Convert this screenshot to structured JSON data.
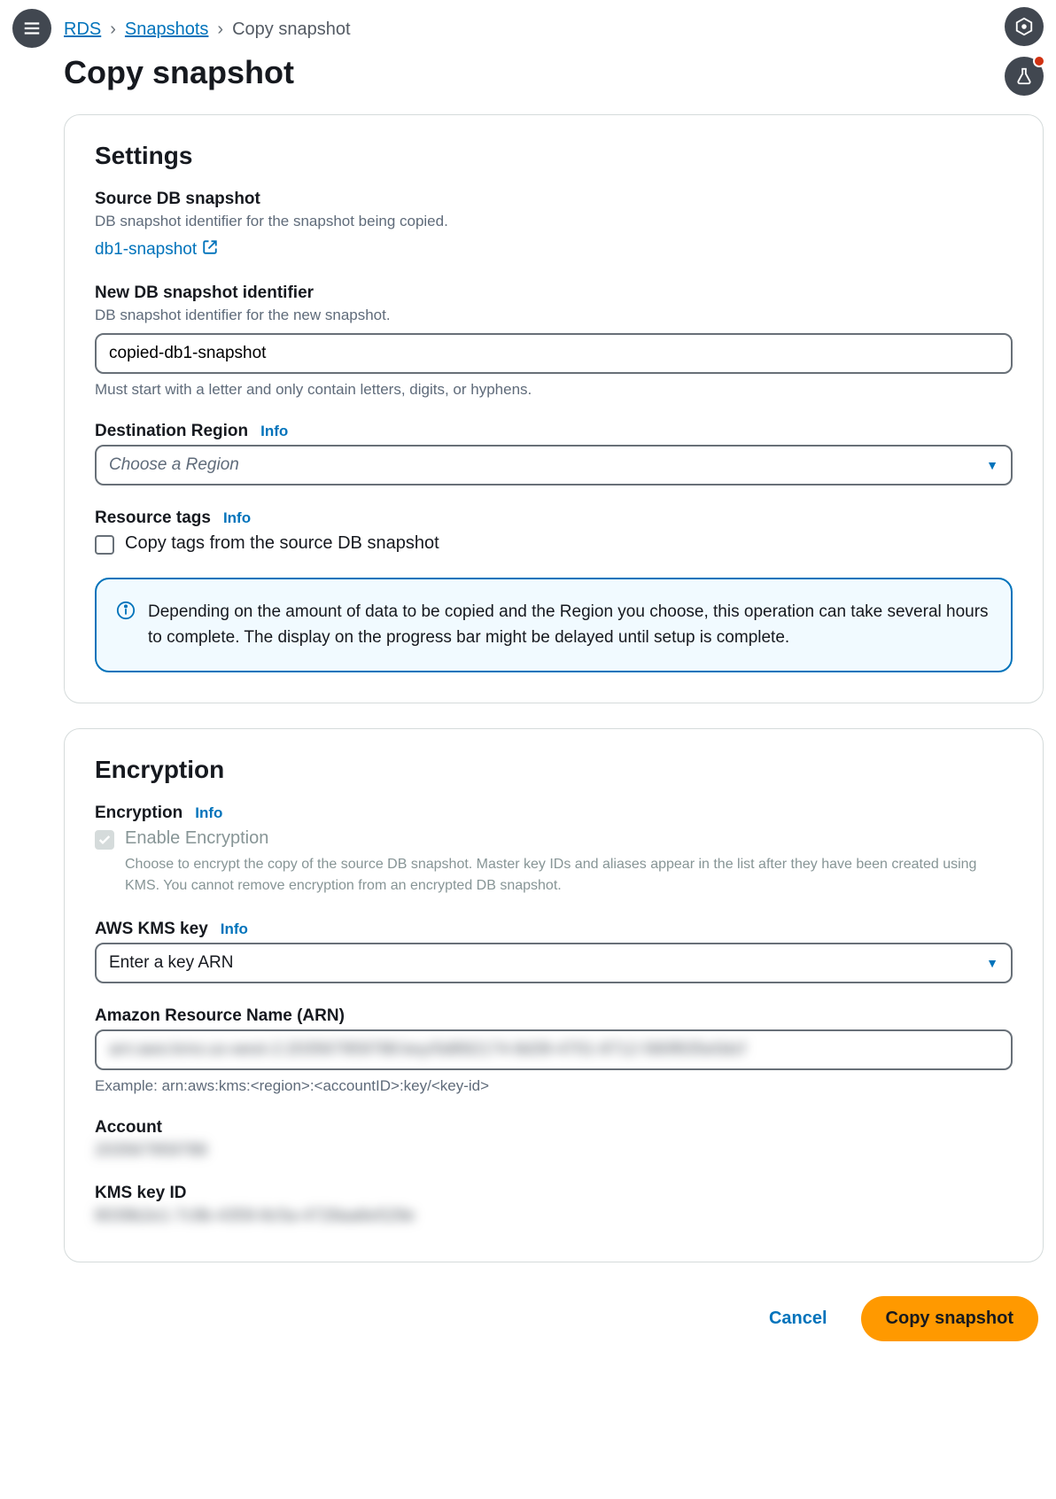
{
  "breadcrumb": {
    "root": "RDS",
    "mid": "Snapshots",
    "current": "Copy snapshot"
  },
  "page_title": "Copy snapshot",
  "settings": {
    "heading": "Settings",
    "source": {
      "label": "Source DB snapshot",
      "desc": "DB snapshot identifier for the snapshot being copied.",
      "link_text": "db1-snapshot"
    },
    "new_id": {
      "label": "New DB snapshot identifier",
      "desc": "DB snapshot identifier for the new snapshot.",
      "value": "copied-db1-snapshot",
      "hint": "Must start with a letter and only contain letters, digits, or hyphens."
    },
    "region": {
      "label": "Destination Region",
      "info": "Info",
      "placeholder": "Choose a Region"
    },
    "tags": {
      "label": "Resource tags",
      "info": "Info",
      "checkbox_label": "Copy tags from the source DB snapshot"
    },
    "alert": "Depending on the amount of data to be copied and the Region you choose, this operation can take several hours to complete. The display on the progress bar might be delayed until setup is complete."
  },
  "encryption": {
    "heading": "Encryption",
    "enc": {
      "label": "Encryption",
      "info": "Info",
      "checkbox_label": "Enable Encryption",
      "desc": "Choose to encrypt the copy of the source DB snapshot. Master key IDs and aliases appear in the list after they have been created using KMS. You cannot remove encryption from an encrypted DB snapshot."
    },
    "kms": {
      "label": "AWS KMS key",
      "info": "Info",
      "value": "Enter a key ARN"
    },
    "arn": {
      "label": "Amazon Resource Name (ARN)",
      "value": "arn:aws:kms:us-west-2:203567959788:key/0d892174-8d39-4701-8712-580f835e0dcf",
      "hint": "Example: arn:aws:kms:<region>:<accountID>:key/<key-id>"
    },
    "account": {
      "label": "Account",
      "value": "203567959788"
    },
    "keyid": {
      "label": "KMS key ID",
      "value": "8039b2e1-7c9b-4359-8c5a-4728aa6e529e"
    }
  },
  "footer": {
    "cancel": "Cancel",
    "submit": "Copy snapshot"
  }
}
